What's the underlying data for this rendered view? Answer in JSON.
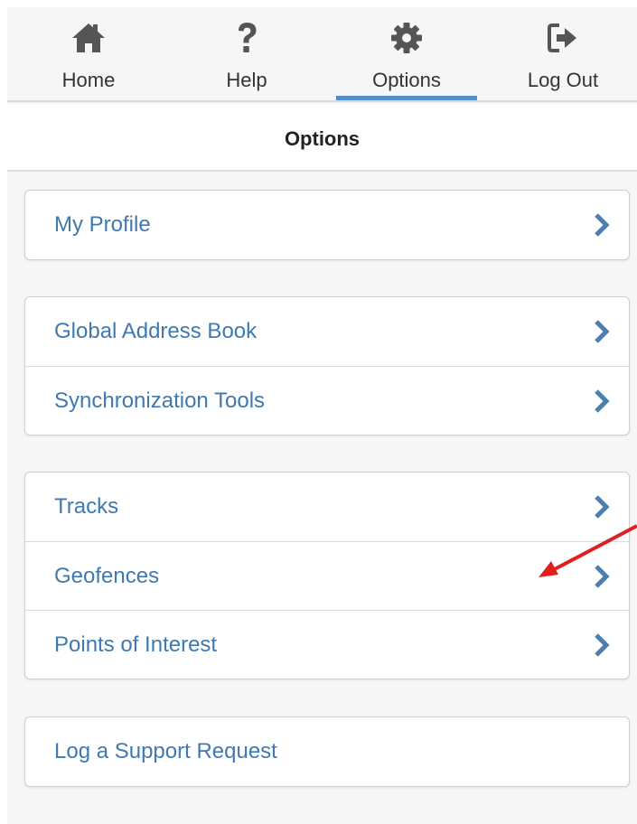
{
  "nav": {
    "items": [
      {
        "label": "Home",
        "icon": "home-icon"
      },
      {
        "label": "Help",
        "icon": "help-icon"
      },
      {
        "label": "Options",
        "icon": "gear-icon",
        "active": true
      },
      {
        "label": "Log Out",
        "icon": "log-out-icon"
      }
    ],
    "active_color": "#4f8fd0"
  },
  "header": {
    "title": "Options"
  },
  "groups": [
    {
      "items": [
        {
          "label": "My Profile",
          "chevron": true
        }
      ]
    },
    {
      "items": [
        {
          "label": "Global Address Book",
          "chevron": true
        },
        {
          "label": "Synchronization Tools",
          "chevron": true
        }
      ]
    },
    {
      "items": [
        {
          "label": "Tracks",
          "chevron": true
        },
        {
          "label": "Geofences",
          "chevron": true
        },
        {
          "label": "Points of Interest",
          "chevron": true
        }
      ]
    },
    {
      "items": [
        {
          "label": "Log a Support Request",
          "chevron": false
        }
      ]
    }
  ],
  "colors": {
    "link": "#3f79b0",
    "chevron": "#4a7fb0",
    "annotation_arrow": "#e02020"
  }
}
